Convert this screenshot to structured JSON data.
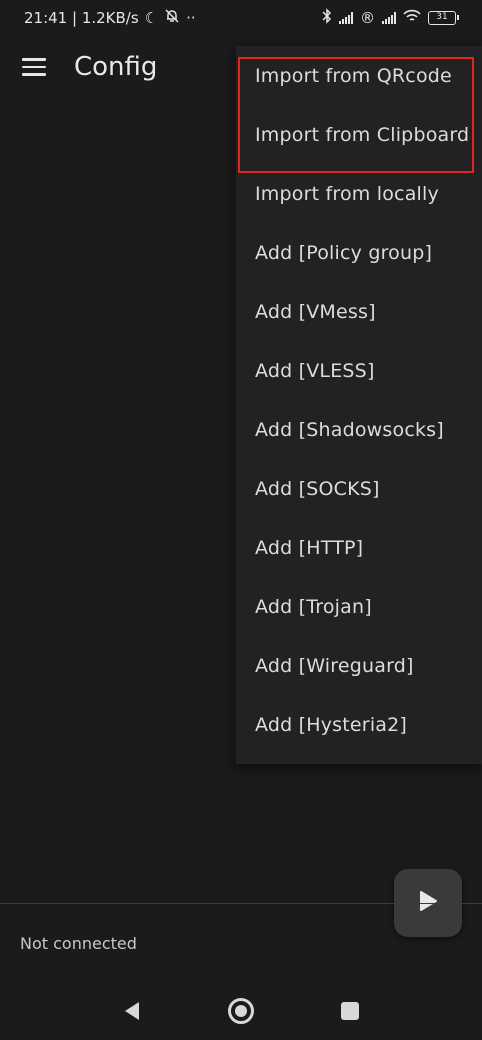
{
  "status_bar": {
    "time_speed": "21:41 | 1.2KB/s",
    "dots": "··",
    "registered_mark": "®",
    "battery": "31"
  },
  "app_bar": {
    "title": "Config"
  },
  "menu": {
    "items": [
      "Import from QRcode",
      "Import from Clipboard",
      "Import from locally",
      "Add [Policy group]",
      "Add [VMess]",
      "Add [VLESS]",
      "Add [Shadowsocks]",
      "Add [SOCKS]",
      "Add [HTTP]",
      "Add [Trojan]",
      "Add [Wireguard]",
      "Add [Hysteria2]"
    ]
  },
  "connection": {
    "status": "Not connected"
  },
  "colors": {
    "background": "#1b1b1d",
    "menu_background": "#222224",
    "highlight_border": "#e0261f"
  }
}
